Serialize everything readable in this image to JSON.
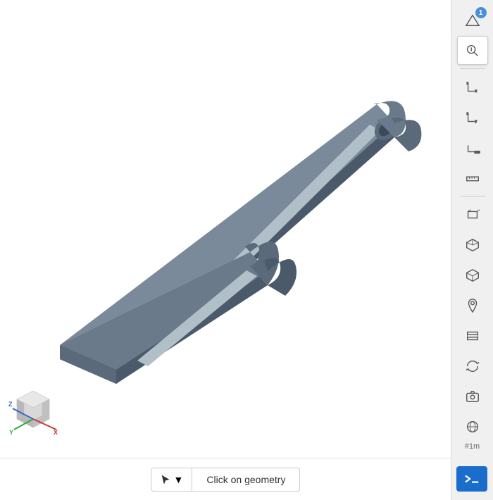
{
  "toolbar": {
    "badge_number": "1",
    "click_geometry_label": "Click on geometry",
    "cursor_icon": "cursor",
    "terminal_label": "terminal",
    "scale_label": "#1m"
  },
  "tools": [
    {
      "name": "dimension-icon",
      "label": "Dimension"
    },
    {
      "name": "zoom-measure-icon",
      "label": "Zoom Measure",
      "active": true
    },
    {
      "name": "axis-xy-icon",
      "label": "Axis XY"
    },
    {
      "name": "axis-xz-icon",
      "label": "Axis XZ"
    },
    {
      "name": "axis-zy-icon",
      "label": "Axis ZY"
    },
    {
      "name": "ruler-icon",
      "label": "Ruler"
    },
    {
      "name": "view-front-icon",
      "label": "View Front"
    },
    {
      "name": "view-back-icon",
      "label": "View Back"
    },
    {
      "name": "view-3d-icon",
      "label": "View 3D"
    },
    {
      "name": "location-icon",
      "label": "Location"
    },
    {
      "name": "measure-icon",
      "label": "Measure"
    },
    {
      "name": "refresh-icon",
      "label": "Refresh"
    },
    {
      "name": "camera-icon",
      "label": "Camera"
    },
    {
      "name": "sphere-icon",
      "label": "Sphere"
    }
  ]
}
